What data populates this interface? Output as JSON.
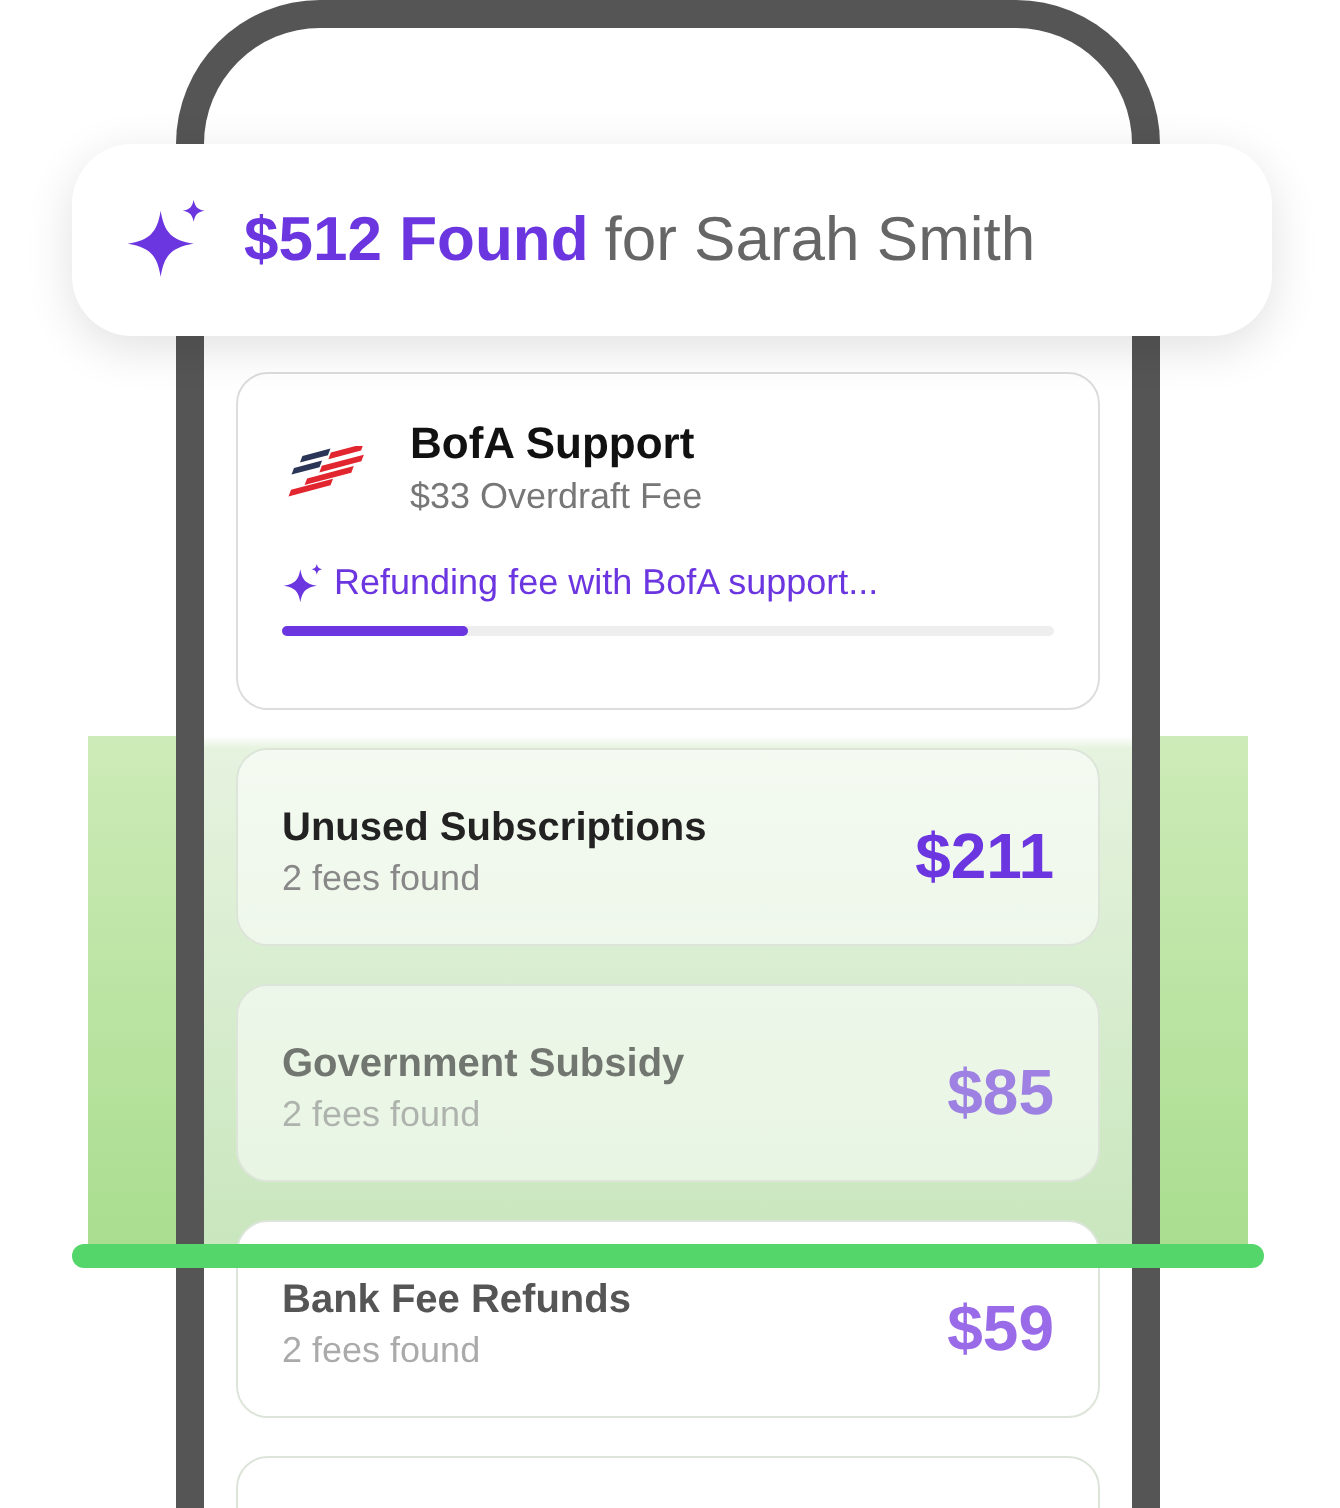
{
  "banner": {
    "amount": "$512 Found",
    "suffix": "for Sarah Smith"
  },
  "task": {
    "title": "BofA Support",
    "subtitle": "$33 Overdraft Fee",
    "status": "Refunding fee with BofA support...",
    "level": 0.24
  },
  "categories": [
    {
      "title": "Unused Subscriptions",
      "subtitle": "2 fees found",
      "amount": "$211",
      "blurred": false,
      "faded": false
    },
    {
      "title": "Government Subsidy",
      "subtitle": "2 fees found",
      "amount": "$85",
      "blurred": true,
      "faded": false
    },
    {
      "title": "Bank Fee Refunds",
      "subtitle": "2 fees found",
      "amount": "$59",
      "blurred": false,
      "faded": true
    }
  ]
}
